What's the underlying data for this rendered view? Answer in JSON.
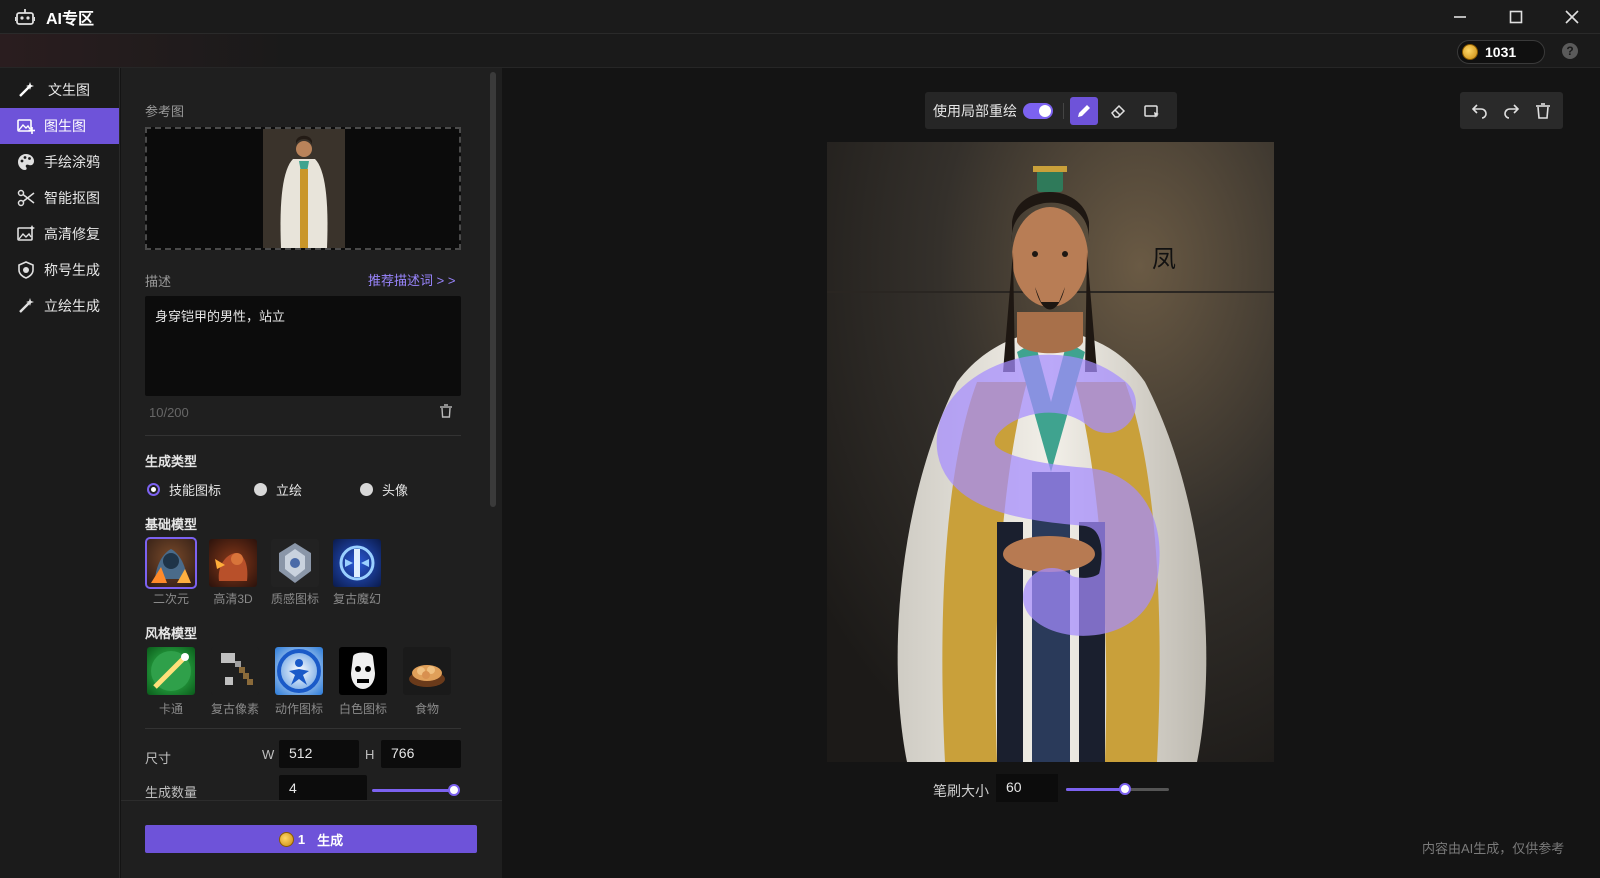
{
  "window": {
    "title": "AI专区"
  },
  "account": {
    "coins": "1031",
    "help": "?"
  },
  "nav": {
    "items": [
      {
        "label": "文生图",
        "icon": "magic-wand-icon"
      },
      {
        "label": "图生图",
        "icon": "image-add-icon",
        "active": true
      },
      {
        "label": "手绘涂鸦",
        "icon": "palette-icon"
      },
      {
        "label": "智能抠图",
        "icon": "scissors-icon"
      },
      {
        "label": "高清修复",
        "icon": "image-enhance-icon"
      },
      {
        "label": "称号生成",
        "icon": "shield-badge-icon"
      },
      {
        "label": "立绘生成",
        "icon": "magic-wand-icon"
      }
    ]
  },
  "panel": {
    "reference_label": "参考图",
    "description_label": "描述",
    "recommend_link": "推荐描述词 > >",
    "description_value": "身穿铠甲的男性，站立",
    "char_count": "10/200",
    "gen_type_title": "生成类型",
    "gen_types": [
      {
        "label": "技能图标",
        "checked": true
      },
      {
        "label": "立绘",
        "checked": false
      },
      {
        "label": "头像",
        "checked": false
      }
    ],
    "base_model_title": "基础模型",
    "base_models": [
      {
        "label": "二次元",
        "selected": true
      },
      {
        "label": "高清3D",
        "selected": false
      },
      {
        "label": "质感图标",
        "selected": false
      },
      {
        "label": "复古魔幻",
        "selected": false
      }
    ],
    "style_model_title": "风格模型",
    "style_models": [
      {
        "label": "卡通"
      },
      {
        "label": "复古像素"
      },
      {
        "label": "动作图标"
      },
      {
        "label": "白色图标"
      },
      {
        "label": "食物"
      }
    ],
    "size_label": "尺寸",
    "width_prefix": "W",
    "width_value": "512",
    "height_prefix": "H",
    "height_value": "766",
    "count_label": "生成数量",
    "count_value": "4",
    "count_slider_fraction": 1.0
  },
  "generate": {
    "cost": "1",
    "label": "生成"
  },
  "canvas": {
    "local_redraw_label": "使用局部重绘",
    "local_redraw_enabled": true,
    "brush_label": "笔刷大小",
    "brush_value": "60",
    "brush_slider_fraction": 0.57,
    "disclaimer": "内容由AI生成，仅供参考"
  },
  "colors": {
    "accent": "#6e53d9",
    "mask": "#a58cff"
  }
}
